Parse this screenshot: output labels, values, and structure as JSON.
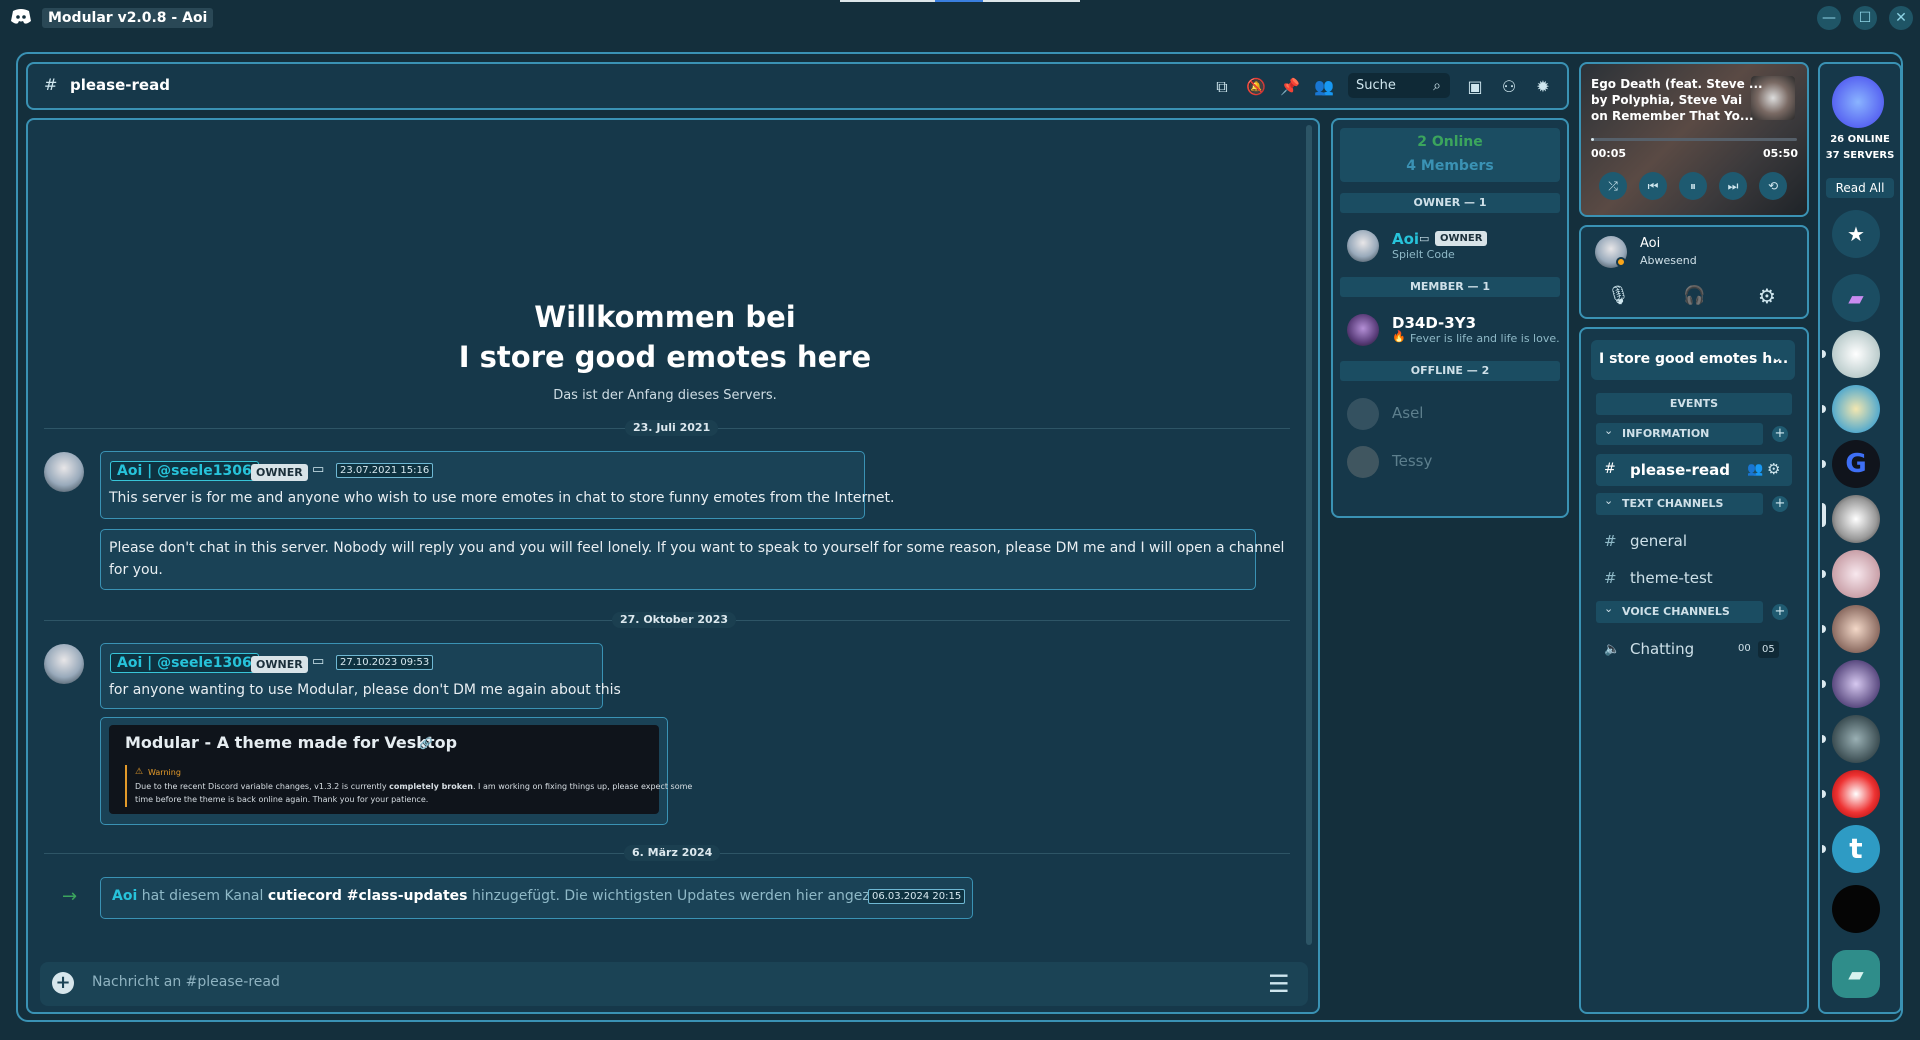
{
  "window": {
    "title": "Modular v2.0.8 - Aoi"
  },
  "header": {
    "channel": "please-read",
    "search_placeholder": "Suche"
  },
  "welcome": {
    "line1": "Willkommen bei",
    "line2": "I store good emotes here",
    "subtitle": "Das ist der Anfang dieses Servers."
  },
  "messages": [
    {
      "date": "23. Juli 2021",
      "username": "Aoi | @seele1306",
      "badge": "OWNER",
      "timestamp": "23.07.2021 15:16",
      "texts": [
        "This server is for me and anyone who wish to use more emotes in chat to store funny emotes from the Internet.",
        "Please don't chat in this server. Nobody will reply you and you will feel lonely. If you want to speak to yourself for some reason, please DM me and I will open a channel",
        "for you."
      ]
    },
    {
      "date": "27. Oktober 2023",
      "username": "Aoi | @seele1306",
      "badge": "OWNER",
      "timestamp": "27.10.2023 09:53",
      "text": "for anyone wanting to use Modular, please don't DM me again about this",
      "embed": {
        "title": "Modular - A theme made for Vesktop",
        "warning_label": "Warning",
        "warning_text_pre": "Due to the recent Discord variable changes, v1.3.2 is currently ",
        "warning_text_bold": "completely broken",
        "warning_text_post": ". I am working on fixing things up, please expect some",
        "warning_text_line2": "time before the theme is back online again. Thank you for your patience."
      }
    },
    {
      "date": "6. März 2024",
      "system_user": "Aoi",
      "system_text_1": "hat diesem Kanal",
      "system_bold": "cutiecord #class-updates",
      "system_text_2": "hinzugefügt. Die wichtigsten Updates werden hier angezeigt.",
      "timestamp": "06.03.2024 20:15"
    }
  ],
  "input": {
    "placeholder": "Nachricht an #please-read"
  },
  "members": {
    "online": "2 Online",
    "total": "4 Members",
    "groups": [
      {
        "title": "OWNER — 1",
        "items": [
          {
            "name": "Aoi",
            "tag": "OWNER",
            "status": "Spielt Code"
          }
        ]
      },
      {
        "title": "MEMBER — 1",
        "items": [
          {
            "name": "D34D-3Y3",
            "status": "Fever is life and life is love."
          }
        ]
      },
      {
        "title": "OFFLINE — 2",
        "items": [
          {
            "name": "Asel"
          },
          {
            "name": "Tessy"
          }
        ]
      }
    ]
  },
  "player": {
    "title": "Ego Death (feat. Steve ...",
    "artist": "by Polyphia, Steve Vai",
    "album": "on Remember That Yo...",
    "elapsed": "00:05",
    "duration": "05:50",
    "progress_fraction": 0.014
  },
  "user": {
    "name": "Aoi",
    "status": "Abwesend"
  },
  "channels": {
    "server_name": "I store good emotes h...",
    "events": "EVENTS",
    "categories": [
      {
        "name": "INFORMATION",
        "channels": [
          "please-read"
        ]
      },
      {
        "name": "TEXT CHANNELS",
        "channels": [
          "general",
          "theme-test"
        ]
      },
      {
        "name": "VOICE CHANNELS",
        "channels": [
          "Chatting"
        ]
      }
    ],
    "voice_counts": [
      "00",
      "05"
    ]
  },
  "servers": {
    "online": "26 ONLINE",
    "count": "37 SERVERS",
    "read_all": "Read All"
  },
  "colors": {
    "accent": "#3a92b4",
    "username": "#27c3da",
    "online": "#3ba55d",
    "background": "#16384a"
  }
}
